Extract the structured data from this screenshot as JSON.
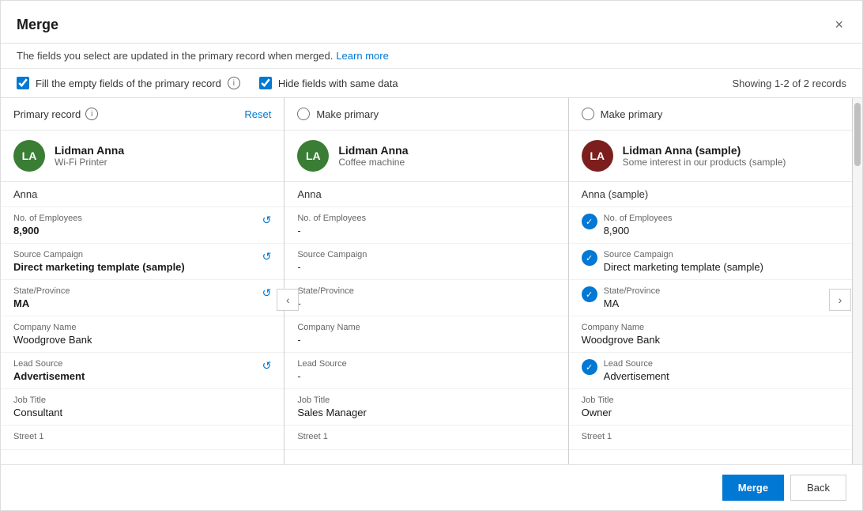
{
  "dialog": {
    "title": "Merge",
    "subtitle": "The fields you select are updated in the primary record when merged.",
    "learn_more": "Learn more",
    "close_label": "×",
    "showing_count": "Showing 1-2 of 2 records"
  },
  "options": {
    "fill_empty_checkbox_label": "Fill the empty fields of the primary record",
    "hide_same_checkbox_label": "Hide fields with same data",
    "fill_checked": true,
    "hide_checked": true
  },
  "columns": [
    {
      "id": "primary",
      "header_type": "primary",
      "header_label": "Primary record",
      "reset_label": "Reset",
      "avatar_initials": "LA",
      "avatar_color": "green",
      "record_name": "Lidman Anna",
      "record_subtitle": "Wi-Fi Printer",
      "first_name": "Anna",
      "fields": [
        {
          "label": "No. of Employees",
          "value": "8,900",
          "bold": true,
          "has_action": true
        },
        {
          "label": "Source Campaign",
          "value": "Direct marketing template (sample)",
          "bold": true,
          "has_action": true
        },
        {
          "label": "State/Province",
          "value": "MA",
          "bold": true,
          "has_action": true
        },
        {
          "label": "Company Name",
          "value": "Woodgrove Bank",
          "bold": false,
          "has_action": false
        },
        {
          "label": "Lead Source",
          "value": "Advertisement",
          "bold": true,
          "has_action": true
        },
        {
          "label": "Job Title",
          "value": "Consultant",
          "bold": false,
          "has_action": false
        },
        {
          "label": "Street 1",
          "value": "",
          "bold": false,
          "has_action": false
        }
      ]
    },
    {
      "id": "record2",
      "header_type": "make-primary",
      "header_label": "Make primary",
      "avatar_initials": "LA",
      "avatar_color": "green",
      "record_name": "Lidman Anna",
      "record_subtitle": "Coffee machine",
      "first_name": "Anna",
      "fields": [
        {
          "label": "No. of Employees",
          "value": "-",
          "bold": false,
          "has_action": false
        },
        {
          "label": "Source Campaign",
          "value": "-",
          "bold": false,
          "has_action": false
        },
        {
          "label": "State/Province",
          "value": "-",
          "bold": false,
          "has_action": false
        },
        {
          "label": "Company Name",
          "value": "-",
          "bold": false,
          "has_action": false
        },
        {
          "label": "Lead Source",
          "value": "-",
          "bold": false,
          "has_action": false
        },
        {
          "label": "Job Title",
          "value": "Sales Manager",
          "bold": false,
          "has_action": false
        },
        {
          "label": "Street 1",
          "value": "",
          "bold": false,
          "has_action": false
        }
      ]
    },
    {
      "id": "record3",
      "header_type": "make-primary",
      "header_label": "Make primary",
      "avatar_initials": "LA",
      "avatar_color": "darkred",
      "record_name": "Lidman Anna (sample)",
      "record_subtitle": "Some interest in our products (sample)",
      "first_name": "Anna (sample)",
      "fields": [
        {
          "label": "No. of Employees",
          "value": "8,900",
          "bold": false,
          "has_action": false,
          "checked": true
        },
        {
          "label": "Source Campaign",
          "value": "Direct marketing template (sample)",
          "bold": false,
          "has_action": false,
          "checked": true
        },
        {
          "label": "State/Province",
          "value": "MA",
          "bold": false,
          "has_action": false,
          "checked": true
        },
        {
          "label": "Company Name",
          "value": "Woodgrove Bank",
          "bold": false,
          "has_action": false
        },
        {
          "label": "Lead Source",
          "value": "Advertisement",
          "bold": false,
          "has_action": false,
          "checked": true
        },
        {
          "label": "Job Title",
          "value": "Owner",
          "bold": false,
          "has_action": false
        },
        {
          "label": "Street 1",
          "value": "",
          "bold": false,
          "has_action": false
        }
      ]
    }
  ],
  "footer": {
    "merge_label": "Merge",
    "back_label": "Back"
  }
}
